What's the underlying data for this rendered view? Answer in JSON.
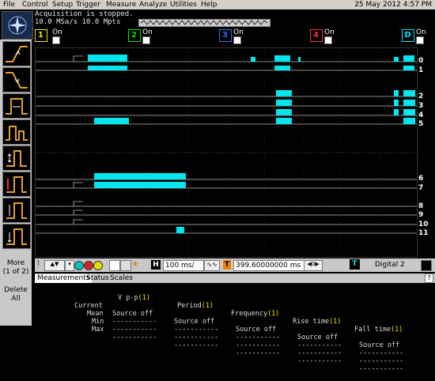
{
  "menu": {
    "items": [
      "File",
      "Control",
      "Setup",
      "Trigger",
      "Measure",
      "Analyze",
      "Utilities",
      "Help"
    ],
    "datetime": "25 May 2012  4:57 PM"
  },
  "status": {
    "line1": "Acquisition is stopped.",
    "line2": "10.0 MSa/s   10.0 Mpts"
  },
  "channels": [
    {
      "num": "1",
      "on": "On",
      "color": "#ffe000"
    },
    {
      "num": "2",
      "on": "On",
      "color": "#00e000"
    },
    {
      "num": "3",
      "on": "On",
      "color": "#3a6cff"
    },
    {
      "num": "4",
      "on": "On",
      "color": "#ff3030"
    },
    {
      "num": "D",
      "on": "On",
      "color": "#00e0ff"
    }
  ],
  "sidebar": {
    "more_label": "More",
    "more_page": "(1 of 2)",
    "delete_label": "Delete",
    "delete_sub": "All",
    "icons": [
      "rising-edge-trigger-icon",
      "falling-edge-trigger-icon",
      "pulse-width-trigger-icon",
      "runt-trigger-icon",
      "setup-hold-icon",
      "glitch-trigger-icon",
      "timeout-trigger-icon",
      "pattern-trigger-icon",
      "state-trigger-icon",
      "window-trigger-icon"
    ]
  },
  "lanes": [
    "0",
    "1",
    "2",
    "3",
    "4",
    "5",
    "6",
    "7",
    "8",
    "9",
    "10",
    "11"
  ],
  "controls": {
    "timebase": "100 ms/",
    "position": "399.60000000 ms",
    "digital_label": "Digital 2"
  },
  "measurements": {
    "tabs": [
      "Measurements",
      "Status",
      "Scales"
    ],
    "headers": [
      {
        "name": "V p-p",
        "ch": "(1)"
      },
      {
        "name": "Period",
        "ch": "(1)"
      },
      {
        "name": "Frequency",
        "ch": "(1)"
      },
      {
        "name": "Rise time",
        "ch": "(1)"
      },
      {
        "name": "Fall time",
        "ch": "(1)"
      }
    ],
    "rows": [
      {
        "label": "Current",
        "vals": [
          "Source off",
          "Source off",
          "Source off",
          "Source off",
          "Source off"
        ]
      },
      {
        "label": "Mean",
        "vals": [
          "-----------",
          "-----------",
          "-----------",
          "-----------",
          "-----------"
        ]
      },
      {
        "label": "Min",
        "vals": [
          "-----------",
          "-----------",
          "-----------",
          "-----------",
          "-----------"
        ]
      },
      {
        "label": "Max",
        "vals": [
          "-----------",
          "-----------",
          "-----------",
          "-----------",
          "-----------"
        ]
      }
    ]
  },
  "colors": {
    "trace": "#00e5ee",
    "bg": "#000000",
    "panel": "#c8c8c8"
  }
}
